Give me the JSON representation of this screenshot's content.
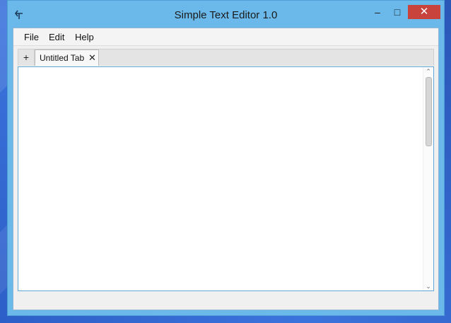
{
  "window": {
    "title": "Simple Text Editor 1.0",
    "app_icon": "back-arrow-icon",
    "controls": {
      "minimize": "–",
      "maximize": "□",
      "close": "✕"
    }
  },
  "menubar": {
    "items": [
      "File",
      "Edit",
      "Help"
    ]
  },
  "tabs": {
    "new_tab_label": "+",
    "items": [
      {
        "label": "Untitled Tab",
        "close": "✕",
        "active": true
      }
    ]
  },
  "editor": {
    "content": "",
    "scroll_up": "⌃",
    "scroll_down": "⌄"
  },
  "colors": {
    "title_bar": "#6bb9ea",
    "close_button": "#c7433c",
    "desktop": "#2f63c9",
    "editor_focus_border": "#5fa8d8"
  }
}
